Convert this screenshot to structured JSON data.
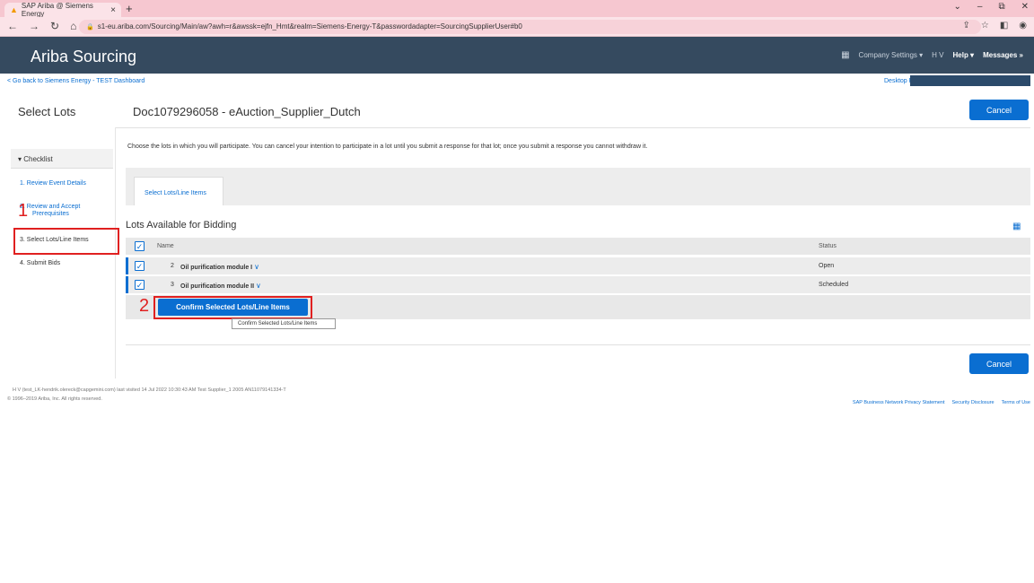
{
  "browser": {
    "tab_title": "SAP Ariba @ Siemens Energy",
    "tab_close": "×",
    "new_tab": "+",
    "url": "s1-eu.ariba.com/Sourcing/Main/aw?awh=r&awssk=ejfn_Hmt&realm=Siemens-Energy-T&passwordadapter=SourcingSupplierUser#b0",
    "window_controls": [
      "⌄",
      "–",
      "⧉",
      "✕"
    ]
  },
  "header": {
    "app_title": "Ariba Sourcing",
    "company_settings": "Company Settings ▾",
    "user_initials": "H V",
    "help": "Help ▾",
    "messages": "Messages »"
  },
  "nav": {
    "back_link": "< Go back to Siemens Energy - TEST Dashboard",
    "desktop_link": "Desktop Fi"
  },
  "page": {
    "left_title": "Select Lots",
    "doc_title": "Doc1079296058 - eAuction_Supplier_Dutch",
    "cancel_label": "Cancel",
    "instruction": "Choose the lots in which you will participate.  You can cancel your intention to participate in a lot until you submit a response for that lot;  once you submit a response you cannot withdraw it."
  },
  "checklist": {
    "title": "▾ Checklist",
    "steps": [
      {
        "label": "1.  Review Event Details"
      },
      {
        "label": "2.  Review and Accept"
      },
      {
        "label": "Prerequisites"
      },
      {
        "label": "3.  Select Lots/Line Items"
      },
      {
        "label": "4.  Submit Bids"
      }
    ]
  },
  "annotations": {
    "mark1": "1",
    "mark2": "2"
  },
  "tabs": {
    "select_lots": "Select Lots/Line Items"
  },
  "lots": {
    "title": "Lots Available for Bidding",
    "columns": {
      "name": "Name",
      "status": "Status"
    },
    "rows": [
      {
        "num": "2",
        "name": "Oil purification module I",
        "status": "Open",
        "checked": "✓"
      },
      {
        "num": "3",
        "name": "Oil purification module II",
        "status": "Scheduled",
        "checked": "✓"
      }
    ],
    "header_check": "✓"
  },
  "actions": {
    "confirm_label": "Confirm Selected Lots/Line Items",
    "tooltip": "Confirm Selected Lots/Line Items"
  },
  "footer": {
    "user_line": "H V (test_LK-hendrik.olereck@capgemini.com) last visited 14 Jul 2022 10:30:43 AM  Test Supplier_1 2005  AN11079141334-T",
    "copyright": "© 1996–2019 Ariba, Inc. All rights reserved.",
    "links": [
      "SAP Business Network Privacy Statement",
      "Security Disclosure",
      "Terms of Use"
    ]
  },
  "colors": {
    "primary": "#0a6ed1",
    "header_bg": "#354a5f",
    "highlight": "#e02020"
  }
}
